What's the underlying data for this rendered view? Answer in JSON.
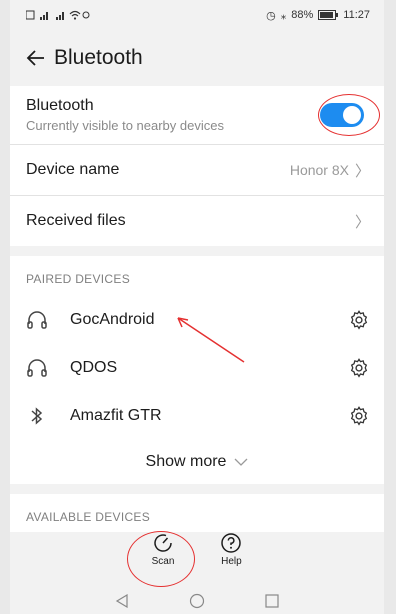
{
  "statusbar": {
    "left": "ⅡⅡⅡ ••• •••",
    "battery": "88%",
    "time": "11:27"
  },
  "appbar": {
    "title": "Bluetooth"
  },
  "bluetooth": {
    "title": "Bluetooth",
    "subtitle": "Currently visible to nearby devices",
    "enabled": true
  },
  "device_name": {
    "label": "Device name",
    "value": "Honor 8X"
  },
  "received_files": {
    "label": "Received files"
  },
  "paired": {
    "header": "PAIRED DEVICES",
    "devices": [
      {
        "name": "GocAndroid",
        "icon": "headphones-icon"
      },
      {
        "name": "QDOS",
        "icon": "headphones-icon"
      },
      {
        "name": "Amazfit GTR",
        "icon": "bluetooth-icon"
      }
    ],
    "show_more": "Show more"
  },
  "available": {
    "header": "AVAILABLE DEVICES"
  },
  "actions": {
    "scan": "Scan",
    "help": "Help"
  },
  "colors": {
    "accent": "#1d8cf0",
    "annotation": "#e53030"
  }
}
